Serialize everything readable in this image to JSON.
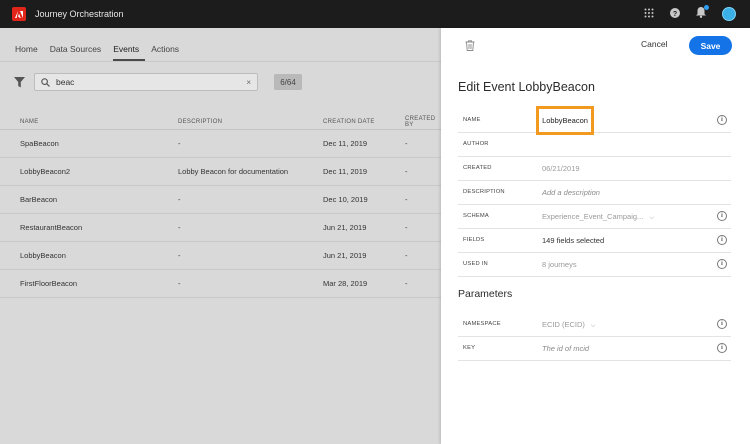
{
  "app": {
    "title": "Journey Orchestration"
  },
  "nav": {
    "items": [
      "Home",
      "Data Sources",
      "Events",
      "Actions"
    ],
    "active": "Events"
  },
  "search": {
    "value": "beac",
    "clear": "×"
  },
  "count": "6/64",
  "table": {
    "headers": [
      "NAME",
      "DESCRIPTION",
      "CREATION DATE",
      "CREATED BY"
    ],
    "rows": [
      {
        "name": "SpaBeacon",
        "description": "-",
        "date": "Dec 11, 2019",
        "by": "-"
      },
      {
        "name": "LobbyBeacon2",
        "description": "Lobby Beacon for documentation",
        "date": "Dec 11, 2019",
        "by": "-"
      },
      {
        "name": "BarBeacon",
        "description": "-",
        "date": "Dec 10, 2019",
        "by": "-"
      },
      {
        "name": "RestaurantBeacon",
        "description": "-",
        "date": "Jun 21, 2019",
        "by": "-"
      },
      {
        "name": "LobbyBeacon",
        "description": "-",
        "date": "Jun 21, 2019",
        "by": "-"
      },
      {
        "name": "FirstFloorBeacon",
        "description": "-",
        "date": "Mar 28, 2019",
        "by": "-"
      }
    ]
  },
  "panel": {
    "cancel": "Cancel",
    "save": "Save",
    "title": "Edit Event LobbyBeacon",
    "fields": {
      "name": {
        "label": "NAME",
        "value": "LobbyBeacon"
      },
      "author": {
        "label": "AUTHOR",
        "value": ""
      },
      "created": {
        "label": "CREATED",
        "value": "06/21/2019"
      },
      "description": {
        "label": "DESCRIPTION",
        "placeholder": "Add a description"
      },
      "schema": {
        "label": "SCHEMA",
        "value": "Experience_Event_Campaig..."
      },
      "fields_count": {
        "label": "FIELDS",
        "value": "149 fields selected"
      },
      "used_in": {
        "label": "USED IN",
        "value": "8 journeys"
      }
    },
    "parameters_title": "Parameters",
    "parameters": {
      "namespace": {
        "label": "NAMESPACE",
        "value": "ECID (ECID)"
      },
      "key": {
        "label": "KEY",
        "placeholder": "The id of mcid"
      }
    },
    "info_glyph": "i"
  },
  "colors": {
    "accent": "#1473e6",
    "highlight": "#f29a20",
    "brand": "#e1251b"
  }
}
